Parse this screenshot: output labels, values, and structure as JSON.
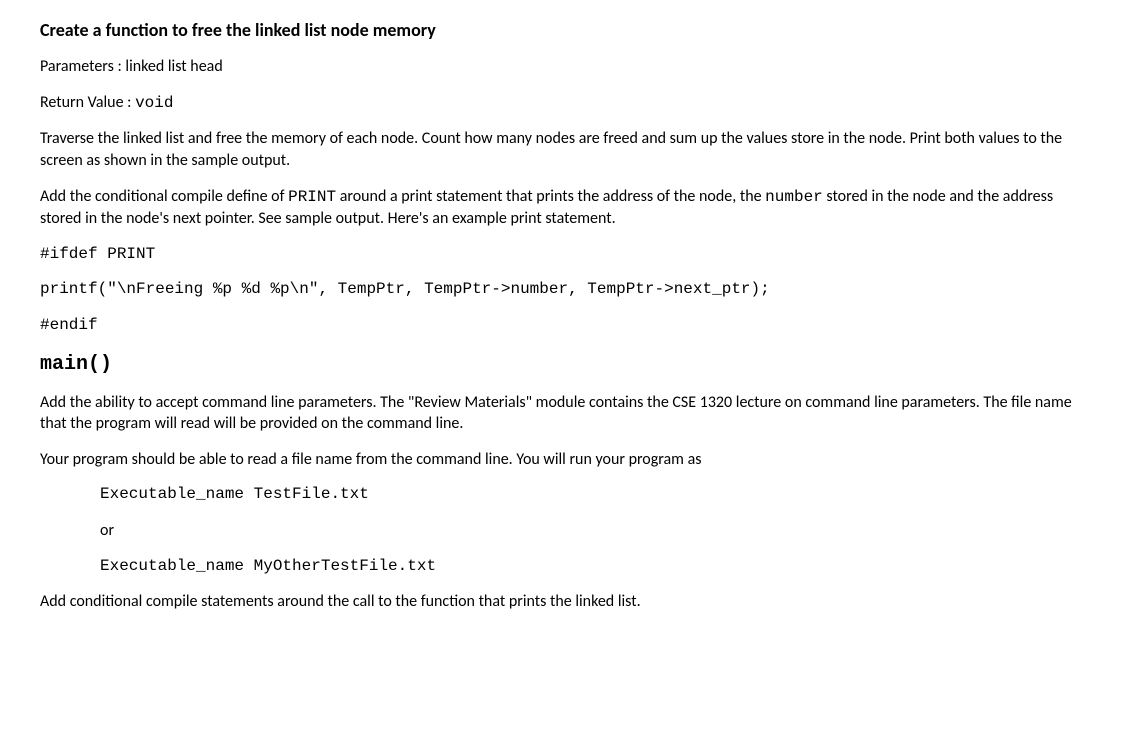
{
  "heading1": "Create a function to free the linked list node memory",
  "params_label": "Parameters : ",
  "params_value": "linked list head",
  "return_label": "Return Value : ",
  "return_value": "void",
  "desc1": "Traverse the linked list and free the memory of each node.  Count how many nodes are freed and sum up the values store in the node.  Print both values to the screen as shown in the sample output.",
  "desc2_a": "Add the conditional compile define of ",
  "desc2_code1": "PRINT",
  "desc2_b": " around a print statement that prints the address of the node, the ",
  "desc2_code2": "number",
  "desc2_c": " stored in the node and the address stored in the node's next pointer.  See sample output. Here's an example print statement.",
  "code_ifdef": "#ifdef PRINT",
  "code_printf": "printf(\"\\nFreeing %p %d %p\\n\", TempPtr, TempPtr->number, TempPtr->next_ptr);",
  "code_endif": "#endif",
  "main_heading": "main()",
  "main_desc1": "Add the ability to accept command line parameters.  The \"Review Materials\" module contains the CSE 1320 lecture on command line parameters.  The file name that the program will read will be provided on the command line.",
  "main_desc2": "Your program should be able to read a file name from the command line.  You will run your program as",
  "example1": "Executable_name TestFile.txt",
  "example_or": "or",
  "example2": "Executable_name MyOtherTestFile.txt",
  "main_desc3": "Add conditional compile statements around the call to the function that prints the linked list."
}
